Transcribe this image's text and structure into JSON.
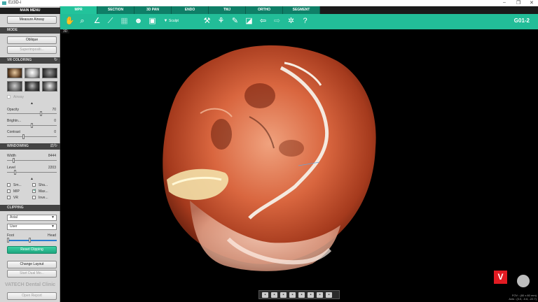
{
  "window": {
    "title": "Ez3D-i",
    "controls": [
      "–",
      "❐",
      "✕"
    ]
  },
  "sidebar": {
    "main_menu": "MAIN MENU",
    "measure_airway": "Measure Airway",
    "mode": {
      "header": "MODE",
      "oblique": "Oblique",
      "superimpose": "Superimpositi..."
    },
    "vr_coloring": {
      "header": "VR COLORING",
      "airway": "Airway",
      "opacity_label": "Opacity",
      "opacity_value": "70",
      "brightness_label": "Brightn...",
      "brightness_value": "0",
      "contrast_label": "Contrast",
      "contrast_value": "0"
    },
    "windowing": {
      "header": "WINDOWING",
      "width_label": "Width",
      "width_value": "8444",
      "level_label": "Level",
      "level_value": "2203",
      "checks": [
        "Sm...",
        "Sha...",
        "MIP",
        "Max...",
        "VR",
        "Inve..."
      ]
    },
    "clipping": {
      "header": "CLIPPING",
      "axis_value": "Axial",
      "mode_value": "User",
      "foot_label": "Foot",
      "head_label": "Head",
      "reset": "Reset Clipping"
    },
    "change_layout": "Change Layout",
    "start_dual": "Start Dual Mo...",
    "watermark": "VATECH Dental Clinic",
    "open_report": "Open Report"
  },
  "tabs": [
    "MPR",
    "SECTION",
    "3D PAN",
    "ENDO",
    "TMJ",
    "ORTHO",
    "SEGMENT"
  ],
  "toolbar": {
    "sculpt_label": "Sculpt",
    "patient_id": "G01-2"
  },
  "viewport": {
    "label": "3D",
    "fov_line1": "FOV : (80 x 80 mm)",
    "fov_line2": "Axis : (3.0, -0.6, -22.7)"
  },
  "logo_letter": "V"
}
